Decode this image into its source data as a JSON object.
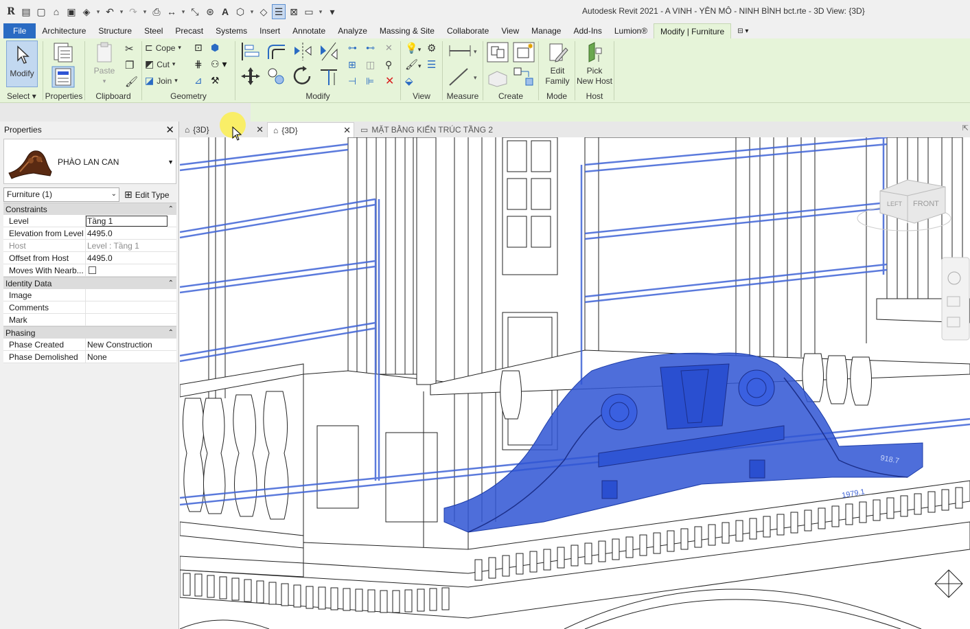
{
  "app": {
    "title": "Autodesk Revit 2021 - A VINH - YÊN MÔ - NINH BÌNH bct.rte - 3D View: {3D}",
    "logo": "R"
  },
  "quick_access": [
    "open-icon",
    "new-icon",
    "save-icon",
    "sync-icon",
    "undo-icon",
    "redo-icon",
    "print-icon",
    "measure-icon",
    "dimension-icon",
    "tag-icon",
    "text-icon",
    "default-3d-icon",
    "section-icon",
    "thin-lines-icon",
    "close-hidden-icon",
    "switch-windows-icon",
    "customize-icon"
  ],
  "menu": {
    "tabs": [
      "File",
      "Architecture",
      "Structure",
      "Steel",
      "Precast",
      "Systems",
      "Insert",
      "Annotate",
      "Analyze",
      "Massing & Site",
      "Collaborate",
      "View",
      "Manage",
      "Add-Ins",
      "Lumion®",
      "Modify | Furniture"
    ],
    "active": "Modify | Furniture"
  },
  "ribbon": {
    "select": {
      "modify": "Modify",
      "label": "Select"
    },
    "properties": {
      "label": "Properties"
    },
    "clipboard": {
      "paste": "Paste",
      "label": "Clipboard"
    },
    "geometry": {
      "cope": "Cope",
      "cut": "Cut",
      "join": "Join",
      "label": "Geometry"
    },
    "modify": {
      "label": "Modify"
    },
    "view": {
      "label": "View"
    },
    "measure": {
      "label": "Measure"
    },
    "create": {
      "label": "Create"
    },
    "mode": {
      "edit1": "Edit",
      "edit2": "Family",
      "label": "Mode"
    },
    "host": {
      "pick1": "Pick",
      "pick2": "New Host",
      "label": "Host"
    }
  },
  "properties": {
    "title": "Properties",
    "type_name": "PHÀO LAN CAN",
    "selector": "Furniture (1)",
    "edit_type": "Edit Type",
    "categories": {
      "constraints": "Constraints",
      "identity": "Identity Data",
      "phasing": "Phasing"
    },
    "rows": {
      "level": {
        "k": "Level",
        "v": "Tầng 1"
      },
      "elevation": {
        "k": "Elevation from Level",
        "v": "4495.0"
      },
      "host": {
        "k": "Host",
        "v": "Level : Tầng 1"
      },
      "offset": {
        "k": "Offset from Host",
        "v": "4495.0"
      },
      "moves": {
        "k": "Moves With Nearb...",
        "v": ""
      },
      "image": {
        "k": "Image",
        "v": ""
      },
      "comments": {
        "k": "Comments",
        "v": ""
      },
      "mark": {
        "k": "Mark",
        "v": ""
      },
      "phase_created": {
        "k": "Phase Created",
        "v": "New Construction"
      },
      "phase_demolished": {
        "k": "Phase Demolished",
        "v": "None"
      }
    }
  },
  "view_tabs": [
    {
      "label": "{3D}"
    },
    {
      "label": "{3D}"
    },
    {
      "label": "MẶT BẰNG KIẾN TRÚC TẦNG 2"
    }
  ],
  "viewcube": {
    "left": "LEFT",
    "front": "FRONT"
  },
  "dims": {
    "d1": "918.7",
    "d2": "1979.1"
  },
  "colors": {
    "ribbon": "#e6f4d9",
    "file_tab": "#2a6bc3",
    "selection": "#2f55d4"
  }
}
